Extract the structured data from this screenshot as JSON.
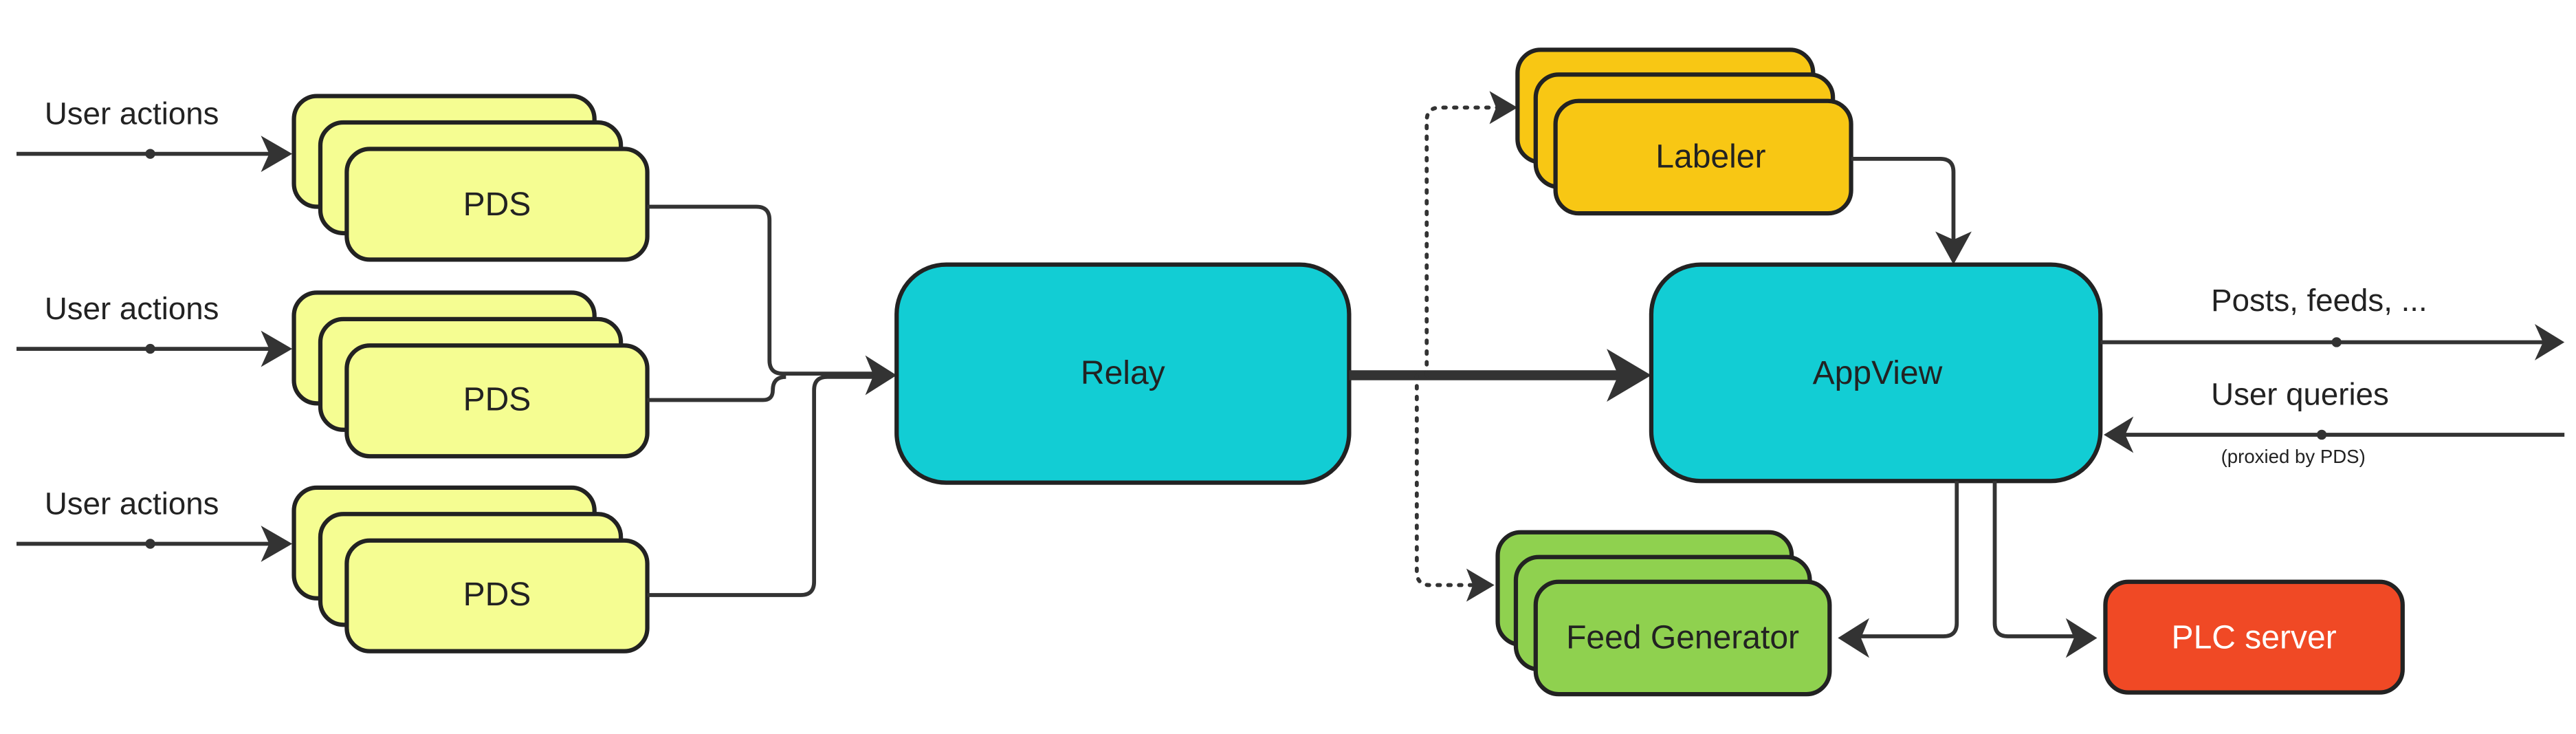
{
  "colors": {
    "pds": "#f5fd92",
    "relay": "#12cdd4",
    "appview": "#12cdd4",
    "labeler": "#f8c714",
    "feed_generator": "#8fd14f",
    "plc_server": "#f04925",
    "stroke": "#222222"
  },
  "nodes": {
    "pds": [
      "PDS",
      "PDS",
      "PDS"
    ],
    "relay": "Relay",
    "appview": "AppView",
    "labeler": "Labeler",
    "feed_generator": "Feed Generator",
    "plc_server": "PLC server"
  },
  "edges": {
    "user_actions": [
      "User actions",
      "User actions",
      "User actions"
    ],
    "posts_feeds": "Posts, feeds, ...",
    "user_queries": "User queries",
    "proxied_note": "(proxied by PDS)"
  }
}
